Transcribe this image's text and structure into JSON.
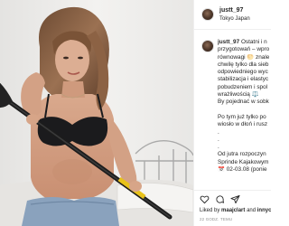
{
  "post": {
    "username": "justt_97",
    "location": "Tokyo Japan"
  },
  "caption": {
    "username": "justt_97",
    "lines": [
      "Ostatni i n",
      "przygotowań – wpro",
      "równowagi 🌕 znale",
      "chwilę tylko dla sieb",
      "odpowiedniego wyc",
      "stabilizacja i elastyc",
      "pobudzeniem i spol",
      "wrażliwością ⚖️",
      "By pojednać w sobk",
      "",
      "Po tym już tylko po",
      "wiosło w dłoń i rusz",
      ".",
      ".",
      ".",
      "Od jutra rozpoczyn",
      "Sprinde Kajakowym",
      "📅 02-03.08 (ponie"
    ]
  },
  "likes": {
    "prefix": "Liked by",
    "user": "maajclart",
    "conjunction": "and",
    "others": "innych"
  },
  "timestamp": "22 GODZ. TEMU",
  "colors": {
    "text": "#262626",
    "muted": "#8e8e8e",
    "border": "#efefef"
  },
  "icons": [
    "heart-icon",
    "comment-icon",
    "share-icon"
  ]
}
